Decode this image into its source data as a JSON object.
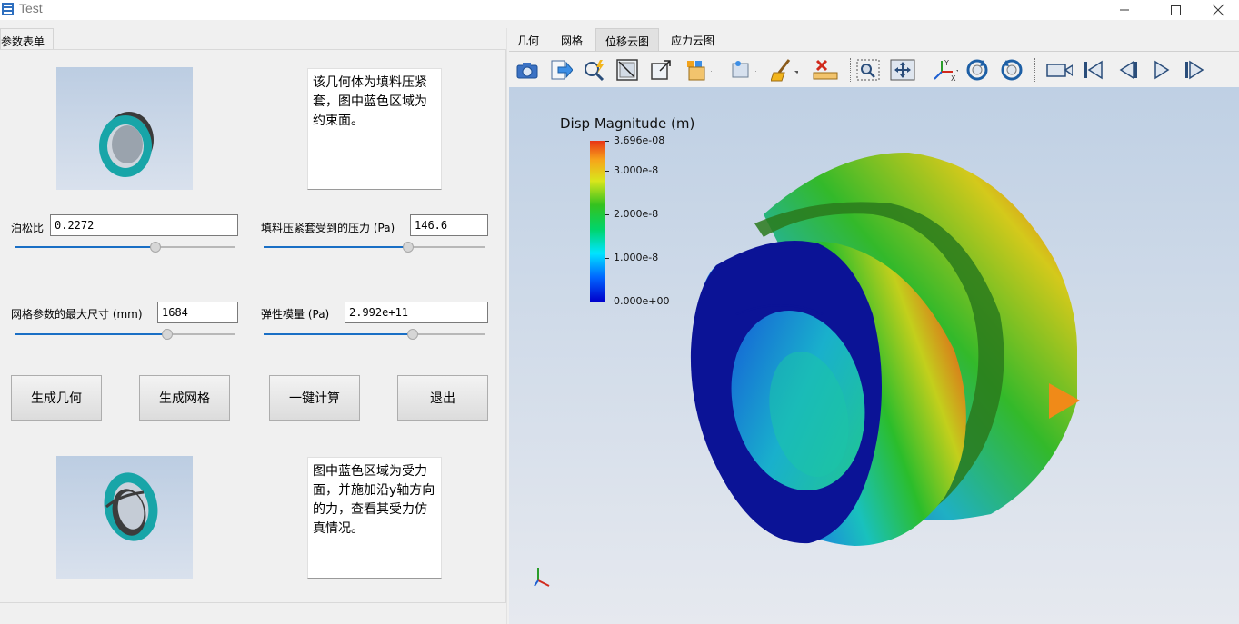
{
  "window": {
    "title": "Test",
    "minimize_symbol": "—",
    "maximize_symbol": "☐",
    "close_symbol": "✕"
  },
  "left_panel": {
    "tab_label": "参数表单",
    "top_note": "该几何体为填料压紧套，图中蓝色区域为约束面。",
    "bottom_note": "图中蓝色区域为受力面，并施加沿y轴方向的力，查看其受力仿真情况。",
    "params": {
      "poisson": {
        "label": "泊松比",
        "value": "0.2272",
        "slider_fraction": 0.64
      },
      "pressure": {
        "label": "填料压紧套受到的压力 (Pa)",
        "value": "146.6",
        "slider_fraction": 0.65
      },
      "mesh_size": {
        "label": "网格参数的最大尺寸 (mm)",
        "value": "1684",
        "slider_fraction": 0.69
      },
      "modulus": {
        "label": "弹性模量 (Pa)",
        "value": "2.992e+11",
        "slider_fraction": 0.67
      }
    },
    "buttons": {
      "generate_geometry": "生成几何",
      "generate_mesh": "生成网格",
      "compute": "一键计算",
      "exit": "退出"
    }
  },
  "right_panel": {
    "tabs": [
      "几何",
      "网格",
      "位移云图",
      "应力云图"
    ],
    "active_tab": 2,
    "toolbar_icons": [
      "camera-icon",
      "export-icon",
      "pick-icon",
      "reset-camera-icon",
      "zoom-to-box-icon",
      "select-cells-icon",
      "select-points-icon",
      "clear-icon",
      "ruler-icon",
      "zoom-region-icon",
      "move-icon",
      "axes-icon",
      "rotate-cw-icon",
      "rotate-ccw-icon",
      "record-icon",
      "first-frame-icon",
      "prev-frame-icon",
      "play-icon",
      "last-frame-icon"
    ],
    "legend": {
      "title": "Disp Magnitude (m)",
      "ticks": [
        "3.696e-08",
        "3.000e-8",
        "2.000e-8",
        "1.000e-8",
        "0.000e+00"
      ],
      "max": 3.696e-08,
      "tick_values": [
        3.696e-08,
        3e-08,
        2e-08,
        1e-08,
        0.0
      ]
    }
  },
  "colors": {
    "accent": "#1a6fc5",
    "viewport_top": "#bfd0e4",
    "viewport_bottom": "#e6e9ef",
    "part_teal": "#18a5a8"
  }
}
